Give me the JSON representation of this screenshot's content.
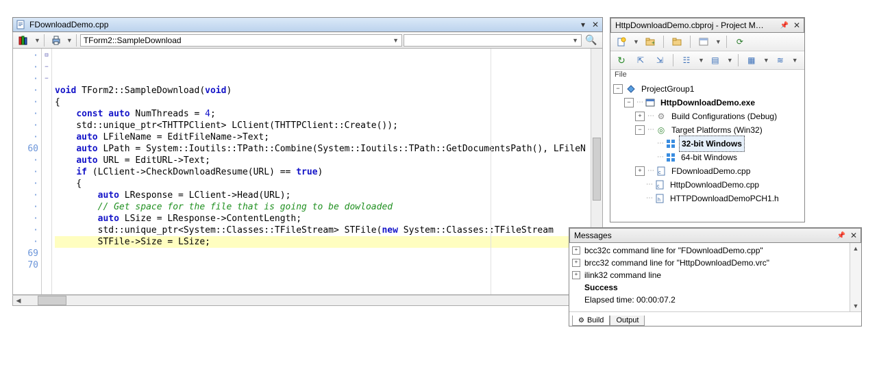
{
  "editor": {
    "tab_title": "FDownloadDemo.cpp",
    "nav_combo": "TForm2::SampleDownload",
    "first_visible_line": 52,
    "line_numbers": [
      "·",
      "·",
      "·",
      "·",
      "·",
      "·",
      "·",
      "·",
      "60",
      "·",
      "·",
      "·",
      "·",
      "·",
      "·",
      "·",
      "·",
      "69",
      "70"
    ],
    "fold_marks": [
      "⊟",
      "",
      "",
      "",
      "−",
      "",
      "",
      "",
      "",
      "",
      "",
      "−",
      "",
      "",
      "",
      "",
      "",
      "",
      ""
    ],
    "highlight_line_index": 17,
    "code_lines": [
      {
        "raw": "void TForm2::SampleDownload(void)",
        "tokens": [
          [
            "kw",
            "void"
          ],
          [
            "",
            " TForm2::SampleDownload("
          ],
          [
            "kw",
            "void"
          ],
          [
            "",
            ")"
          ]
        ]
      },
      {
        "raw": "{",
        "tokens": [
          [
            "",
            "{"
          ]
        ]
      },
      {
        "raw": "    const auto NumThreads = 4;",
        "tokens": [
          [
            "",
            "    "
          ],
          [
            "kw",
            "const"
          ],
          [
            "",
            " "
          ],
          [
            "kw",
            "auto"
          ],
          [
            "",
            " NumThreads = "
          ],
          [
            "num",
            "4"
          ],
          [
            "",
            ";"
          ]
        ]
      },
      {
        "raw": "    std::unique_ptr<THTTPClient> LClient(THTTPClient::Create());",
        "tokens": [
          [
            "",
            "    std::unique_ptr<THTTPClient> LClient(THTTPClient::Create());"
          ]
        ]
      },
      {
        "raw": "",
        "tokens": [
          [
            "",
            ""
          ]
        ]
      },
      {
        "raw": "    auto LFileName = EditFileName->Text;",
        "tokens": [
          [
            "",
            "    "
          ],
          [
            "kw",
            "auto"
          ],
          [
            "",
            " LFileName = EditFileName->Text;"
          ]
        ]
      },
      {
        "raw": "    auto LPath = System::Ioutils::TPath::Combine(System::Ioutils::TPath::GetDocumentsPath(), LFileN",
        "tokens": [
          [
            "",
            "    "
          ],
          [
            "kw",
            "auto"
          ],
          [
            "",
            " LPath = System::Ioutils::TPath::Combine(System::Ioutils::TPath::GetDocumentsPath(), LFileN"
          ]
        ]
      },
      {
        "raw": "",
        "tokens": [
          [
            "",
            ""
          ]
        ]
      },
      {
        "raw": "    auto URL = EditURL->Text;",
        "tokens": [
          [
            "",
            "    "
          ],
          [
            "kw",
            "auto"
          ],
          [
            "",
            " URL = EditURL->Text;"
          ]
        ]
      },
      {
        "raw": "",
        "tokens": [
          [
            "",
            ""
          ]
        ]
      },
      {
        "raw": "    if (LClient->CheckDownloadResume(URL) == true)",
        "tokens": [
          [
            "",
            "    "
          ],
          [
            "kw",
            "if"
          ],
          [
            "",
            " (LClient->CheckDownloadResume(URL) == "
          ],
          [
            "kw",
            "true"
          ],
          [
            "",
            ")"
          ]
        ]
      },
      {
        "raw": "    {",
        "tokens": [
          [
            "",
            "    {"
          ]
        ]
      },
      {
        "raw": "        auto LResponse = LClient->Head(URL);",
        "tokens": [
          [
            "",
            "        "
          ],
          [
            "kw",
            "auto"
          ],
          [
            "",
            " LResponse = LClient->Head(URL);"
          ]
        ]
      },
      {
        "raw": "",
        "tokens": [
          [
            "",
            ""
          ]
        ]
      },
      {
        "raw": "        // Get space for the file that is going to be dowloaded",
        "tokens": [
          [
            "",
            "        "
          ],
          [
            "cm",
            "// Get space for the file that is going to be dowloaded"
          ]
        ]
      },
      {
        "raw": "        auto LSize = LResponse->ContentLength;",
        "tokens": [
          [
            "",
            "        "
          ],
          [
            "kw",
            "auto"
          ],
          [
            "",
            " LSize = LResponse->ContentLength;"
          ]
        ]
      },
      {
        "raw": "        std::unique_ptr<System::Classes::TFileStream> STFile(new System::Classes::TFileStream",
        "tokens": [
          [
            "",
            "        std::unique_ptr<System::Classes::TFileStream> STFile("
          ],
          [
            "kw",
            "new"
          ],
          [
            "",
            " System::Classes::TFileStream"
          ]
        ]
      },
      {
        "raw": "        STFile->Size = LSize;",
        "tokens": [
          [
            "",
            "        STFile->Size = LSize;"
          ]
        ]
      },
      {
        "raw": "",
        "tokens": [
          [
            "",
            ""
          ]
        ]
      }
    ]
  },
  "project": {
    "title": "HttpDownloadDemo.cbproj - Project M…",
    "file_label": "File",
    "tree": [
      {
        "indent": 0,
        "exp": "-",
        "icon": "diamond",
        "label": "ProjectGroup1",
        "bold": false
      },
      {
        "indent": 1,
        "exp": "-",
        "icon": "exe",
        "label": "HttpDownloadDemo.exe",
        "bold": true
      },
      {
        "indent": 2,
        "exp": "+",
        "icon": "gear",
        "label": "Build Configurations (Debug)",
        "bold": false
      },
      {
        "indent": 2,
        "exp": "-",
        "icon": "target",
        "label": "Target Platforms (Win32)",
        "bold": false
      },
      {
        "indent": 3,
        "exp": "",
        "icon": "win",
        "label": "32-bit Windows",
        "bold": true,
        "selected": true
      },
      {
        "indent": 3,
        "exp": "",
        "icon": "win",
        "label": "64-bit Windows",
        "bold": false
      },
      {
        "indent": 2,
        "exp": "+",
        "icon": "cpp",
        "label": "FDownloadDemo.cpp",
        "bold": false
      },
      {
        "indent": 2,
        "exp": "",
        "icon": "cpp",
        "label": "HttpDownloadDemo.cpp",
        "bold": false
      },
      {
        "indent": 2,
        "exp": "",
        "icon": "h",
        "label": "HTTPDownloadDemoPCH1.h",
        "bold": false
      }
    ]
  },
  "messages": {
    "title": "Messages",
    "lines": [
      {
        "exp": true,
        "text": "bcc32c command line for \"FDownloadDemo.cpp\""
      },
      {
        "exp": true,
        "text": "brcc32 command line for \"HttpDownloadDemo.vrc\""
      },
      {
        "exp": true,
        "text": "ilink32 command line"
      },
      {
        "exp": false,
        "text": "Success",
        "bold": true
      },
      {
        "exp": false,
        "text": "Elapsed time: 00:00:07.2"
      }
    ],
    "tabs": [
      {
        "label": "Build",
        "active": true,
        "icon": true
      },
      {
        "label": "Output",
        "active": false,
        "icon": false
      }
    ]
  }
}
